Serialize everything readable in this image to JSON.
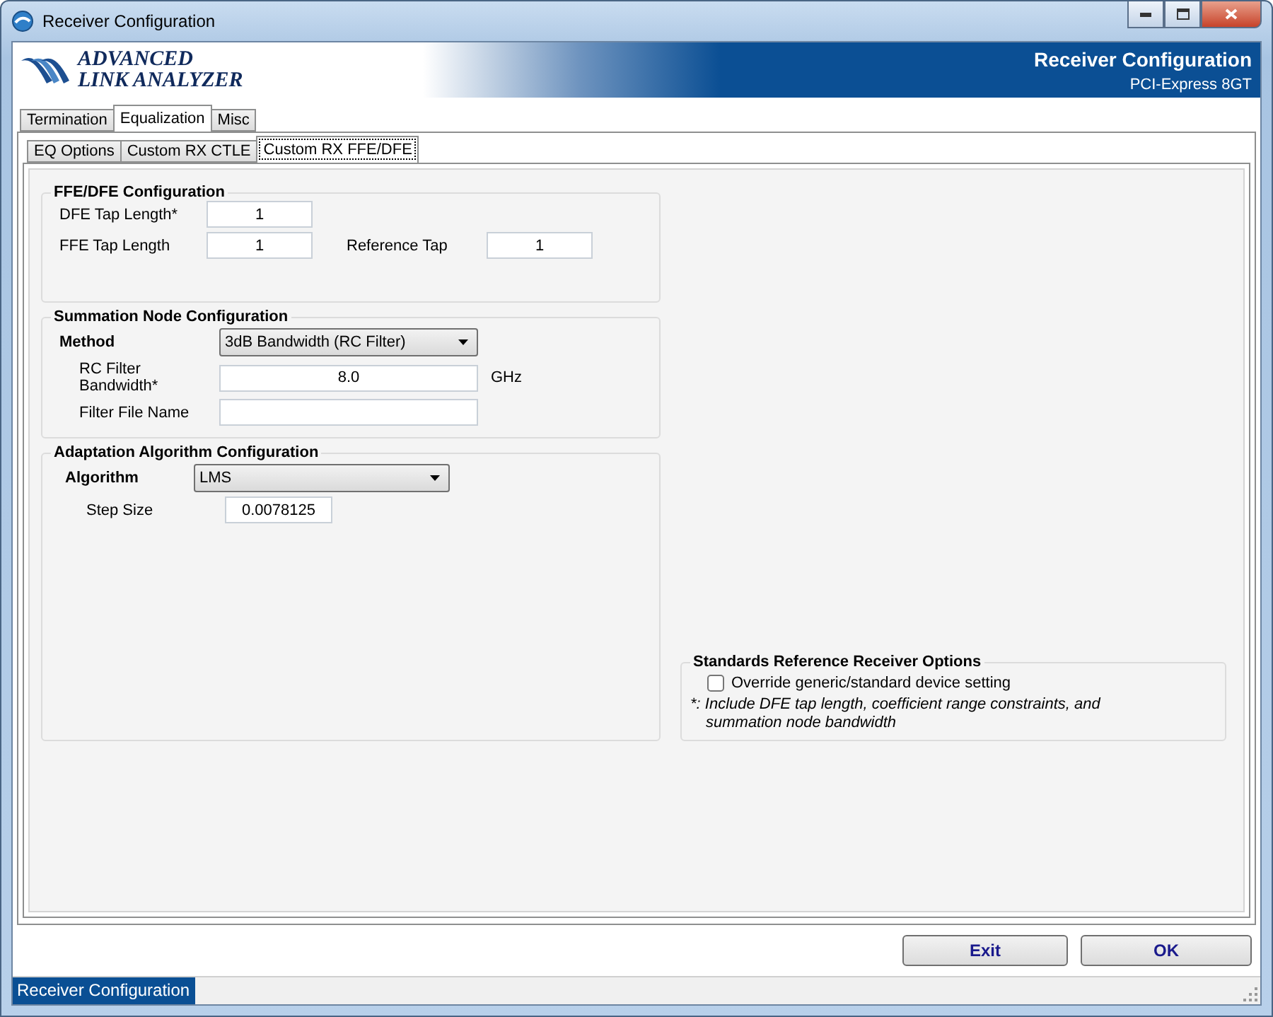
{
  "window": {
    "title": "Receiver Configuration"
  },
  "banner": {
    "logo_line_1": "ADVANCED",
    "logo_line_2": "LINK ANALYZER",
    "title": "Receiver Configuration",
    "subtitle": "PCI-Express 8GT"
  },
  "tabs": [
    {
      "label": "Termination",
      "selected": false
    },
    {
      "label": "Equalization",
      "selected": true
    },
    {
      "label": "Misc",
      "selected": false
    }
  ],
  "subtabs": [
    {
      "label": "EQ Options",
      "selected": false
    },
    {
      "label": "Custom RX CTLE",
      "selected": false
    },
    {
      "label": "Custom RX FFE/DFE",
      "selected": true
    }
  ],
  "ffe_dfe": {
    "title": "FFE/DFE Configuration",
    "dfe_tap_length": {
      "label": "DFE Tap Length*",
      "value": "1"
    },
    "ffe_tap_length": {
      "label": "FFE Tap Length",
      "value": "1"
    },
    "reference_tap": {
      "label": "Reference Tap",
      "value": "1"
    }
  },
  "summation": {
    "title": "Summation Node Configuration",
    "method": {
      "label": "Method",
      "value": "3dB Bandwidth (RC Filter)"
    },
    "bandwidth": {
      "label": "RC Filter Bandwidth*",
      "value": "8.0",
      "unit": "GHz"
    },
    "filter_file": {
      "label": "Filter File Name"
    }
  },
  "adaptation": {
    "title": "Adaptation Algorithm Configuration",
    "algorithm": {
      "label": "Algorithm",
      "value": "LMS"
    },
    "step_size": {
      "label": "Step Size",
      "value": "0.0078125"
    }
  },
  "standards": {
    "title": "Standards Reference Receiver Options",
    "override": {
      "label": "Override generic/standard device setting",
      "checked": false
    },
    "note": "*: Include DFE tap length, coefficient range constraints, and summation node bandwidth"
  },
  "buttons": [
    {
      "label": "Exit"
    },
    {
      "label": "OK"
    }
  ],
  "status_bar": {
    "text": "Receiver Configuration"
  }
}
